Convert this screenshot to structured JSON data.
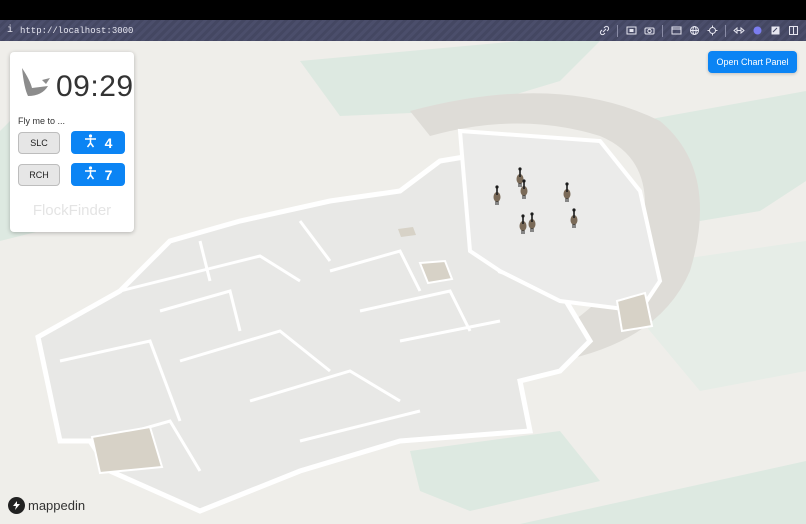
{
  "browser": {
    "url": "http://localhost:3000",
    "info_icon": "info-icon",
    "toolbar_icons": [
      "link-icon",
      "screenshot-icon",
      "camera-icon",
      "window-icon",
      "globe-icon",
      "crosshair-icon",
      "resize-icon",
      "color-dot-icon",
      "notes-icon",
      "panel-icon"
    ],
    "accent_dot_color": "#7b7df0"
  },
  "card": {
    "time": "09:29",
    "prompt": "Fly me to ...",
    "destinations": [
      {
        "code": "SLC",
        "count": "4"
      },
      {
        "code": "RCH",
        "count": "7"
      }
    ],
    "brand": "FlockFinder"
  },
  "chart_panel_button": "Open Chart Panel",
  "logo_text": "mappedin",
  "map": {
    "geese_count": 7,
    "colors": {
      "background": "#efeeea",
      "green_area": "#dde9e1",
      "building_floor": "#e8e8e6",
      "wall": "#ffffff",
      "stair_area": "#d7d2c7",
      "accent_button": "#0b84f4"
    }
  }
}
